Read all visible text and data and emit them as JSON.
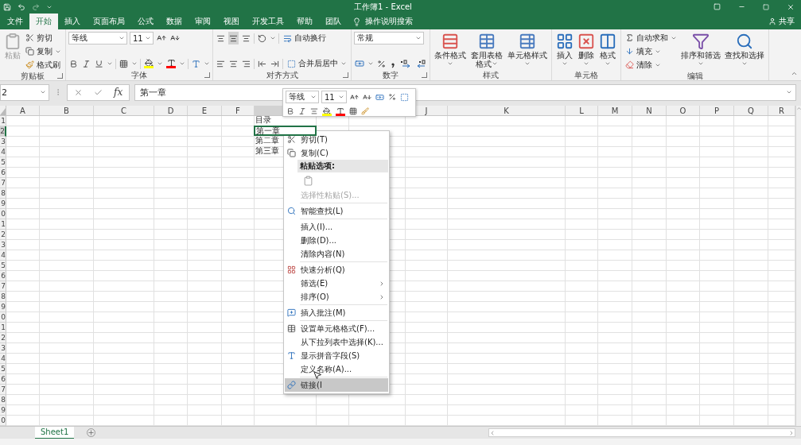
{
  "title_bar": {
    "title": "工作簿1 - Excel"
  },
  "tabs": [
    {
      "label": "文件",
      "selected": false
    },
    {
      "label": "开始",
      "selected": true
    },
    {
      "label": "插入",
      "selected": false
    },
    {
      "label": "页面布局",
      "selected": false
    },
    {
      "label": "公式",
      "selected": false
    },
    {
      "label": "数据",
      "selected": false
    },
    {
      "label": "审阅",
      "selected": false
    },
    {
      "label": "视图",
      "selected": false
    },
    {
      "label": "开发工具",
      "selected": false
    },
    {
      "label": "帮助",
      "selected": false
    },
    {
      "label": "团队",
      "selected": false
    }
  ],
  "tell_me": {
    "placeholder": "操作说明搜索"
  },
  "share": {
    "label": "共享"
  },
  "ribbon": {
    "groups": [
      {
        "kind": "clipboard",
        "label": "剪贴板",
        "launcher": true,
        "paste": {
          "label": "粘贴",
          "disabled": true
        },
        "items": [
          {
            "kind": "cut",
            "label": "剪切"
          },
          {
            "kind": "copy",
            "label": "复制"
          },
          {
            "kind": "painter",
            "label": "格式刷"
          }
        ]
      },
      {
        "kind": "font",
        "label": "字体",
        "launcher": true,
        "font": "等线",
        "size": "11"
      },
      {
        "kind": "align",
        "label": "对齐方式",
        "launcher": true,
        "wrap": "自动换行",
        "merge": "合并后居中"
      },
      {
        "kind": "number",
        "label": "数字",
        "launcher": true,
        "format": "常规"
      },
      {
        "kind": "large",
        "label": "样式",
        "items": [
          {
            "kind": "conditional",
            "label": "条件格式"
          },
          {
            "kind": "table",
            "label": "套用表格格式"
          },
          {
            "kind": "cellstyle",
            "label": "单元格样式"
          }
        ]
      },
      {
        "kind": "large",
        "label": "单元格",
        "items": [
          {
            "kind": "insert",
            "label": "插入"
          },
          {
            "kind": "delete",
            "label": "删除"
          },
          {
            "kind": "format",
            "label": "格式"
          }
        ]
      },
      {
        "kind": "editing",
        "label": "编辑",
        "items": [
          {
            "kind": "sum",
            "label": "自动求和"
          },
          {
            "kind": "fill",
            "label": "填充"
          },
          {
            "kind": "clear",
            "label": "清除"
          }
        ],
        "large": [
          {
            "kind": "sort",
            "label": "排序和筛选"
          },
          {
            "kind": "find",
            "label": "查找和选择"
          }
        ]
      }
    ]
  },
  "formula_bar": {
    "name_box": "2",
    "function_label": "fx",
    "value": "第一章"
  },
  "columns": [
    "A",
    "B",
    "C",
    "D",
    "E",
    "F",
    null,
    null,
    null,
    "J",
    "K",
    "L",
    "M",
    "N",
    "O",
    "P",
    "Q",
    "R"
  ],
  "rows": [
    {
      "number": "1",
      "text": "目录",
      "selected": false
    },
    {
      "number": "2",
      "text": "第一章",
      "selected": true
    },
    {
      "number": "3",
      "text": "第二章",
      "selected": false
    },
    {
      "number": "4",
      "text": "第三章",
      "selected": false
    },
    {
      "number": "5"
    },
    {
      "number": "6"
    },
    {
      "number": "7"
    },
    {
      "number": "8"
    },
    {
      "number": "9"
    },
    {
      "number": "0"
    },
    {
      "number": "1"
    },
    {
      "number": "2"
    },
    {
      "number": "3"
    },
    {
      "number": "4"
    },
    {
      "number": "5"
    },
    {
      "number": "6"
    },
    {
      "number": "7"
    },
    {
      "number": "8"
    },
    {
      "number": "9"
    },
    {
      "number": "0"
    },
    {
      "number": "1"
    },
    {
      "number": "2"
    },
    {
      "number": "3"
    },
    {
      "number": "4"
    },
    {
      "number": "5"
    },
    {
      "number": "6"
    },
    {
      "number": "7"
    },
    {
      "number": "8"
    },
    {
      "number": "9"
    },
    {
      "number": "0"
    }
  ],
  "mini_toolbar": {
    "font": "等线",
    "size": "11"
  },
  "context_menu": {
    "items": [
      {
        "kind": "item",
        "label": "剪切(T)",
        "disabled": false,
        "submenu": false,
        "highlighted": false
      },
      {
        "kind": "item",
        "label": "复制(C)",
        "disabled": false,
        "submenu": false,
        "highlighted": false
      },
      {
        "kind": "header",
        "label": "粘贴选项:"
      },
      {
        "kind": "paste-options"
      },
      {
        "kind": "item",
        "label": "选择性粘贴(S)...",
        "disabled": true,
        "submenu": false,
        "highlighted": false
      },
      {
        "kind": "separator"
      },
      {
        "kind": "item",
        "label": "智能查找(L)",
        "disabled": false,
        "submenu": false,
        "highlighted": false
      },
      {
        "kind": "separator"
      },
      {
        "kind": "item",
        "label": "插入(I)...",
        "disabled": false,
        "submenu": false,
        "highlighted": false
      },
      {
        "kind": "item",
        "label": "删除(D)...",
        "disabled": false,
        "submenu": false,
        "highlighted": false
      },
      {
        "kind": "item",
        "label": "清除内容(N)",
        "disabled": false,
        "submenu": false,
        "highlighted": false
      },
      {
        "kind": "separator"
      },
      {
        "kind": "item",
        "label": "快速分析(Q)",
        "disabled": false,
        "submenu": false,
        "highlighted": false
      },
      {
        "kind": "item",
        "label": "筛选(E)",
        "disabled": false,
        "submenu": true,
        "highlighted": false
      },
      {
        "kind": "item",
        "label": "排序(O)",
        "disabled": false,
        "submenu": true,
        "highlighted": false
      },
      {
        "kind": "separator"
      },
      {
        "kind": "item",
        "label": "插入批注(M)",
        "disabled": false,
        "submenu": false,
        "highlighted": false
      },
      {
        "kind": "separator"
      },
      {
        "kind": "item",
        "label": "设置单元格格式(F)...",
        "disabled": false,
        "submenu": false,
        "highlighted": false
      },
      {
        "kind": "item",
        "label": "从下拉列表中选择(K)...",
        "disabled": false,
        "submenu": false,
        "highlighted": false
      },
      {
        "kind": "item",
        "label": "显示拼音字段(S)",
        "disabled": false,
        "submenu": false,
        "highlighted": false
      },
      {
        "kind": "item",
        "label": "定义名称(A)...",
        "disabled": false,
        "submenu": false,
        "highlighted": false
      },
      {
        "kind": "separator"
      },
      {
        "kind": "item",
        "label": "链接(I",
        "disabled": false,
        "submenu": false,
        "highlighted": true
      }
    ]
  },
  "sheet_tabs": [
    {
      "label": "Sheet1",
      "selected": true
    }
  ]
}
